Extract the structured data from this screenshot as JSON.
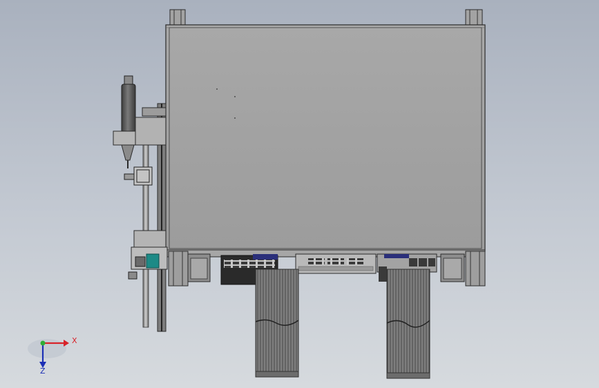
{
  "view": {
    "background_top": "#a9b1be",
    "background_bottom": "#d6dade"
  },
  "model": {
    "body_color": "#a2a2a2",
    "frame_color": "#8f8f8f",
    "accent_teal": "#1d8a86",
    "cable_color": "#555555",
    "dark_part": "#2a2a2a",
    "connector_blue": "#2a2f7a"
  },
  "triad": {
    "x_label": "X",
    "z_label": "Z",
    "x_color": "#d8232a",
    "y_color": "#2fae36",
    "z_color": "#1c2fb5"
  }
}
